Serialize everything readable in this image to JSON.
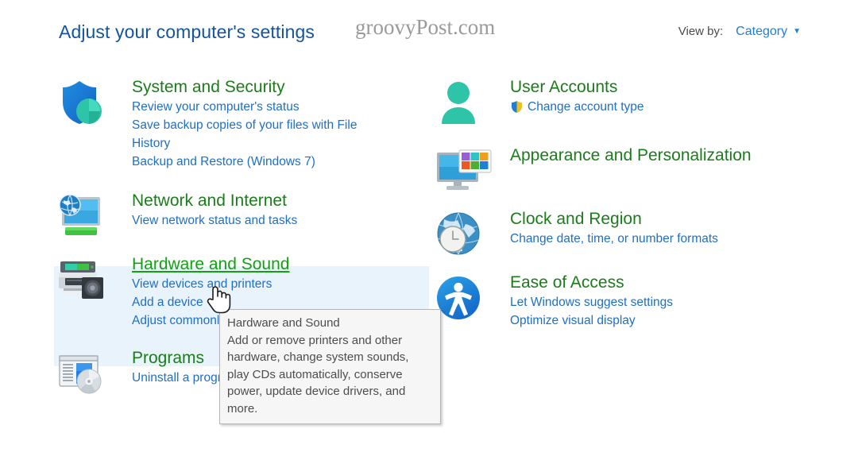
{
  "header": {
    "page_title": "Adjust your computer's settings",
    "watermark": "groovyPost.com",
    "view_by_label": "View by:",
    "view_by_value": "Category",
    "caret_glyph": "▼"
  },
  "colors": {
    "title_blue": "#16539e",
    "link_blue": "#1f6fc4",
    "category_green": "#1a7d1a",
    "hover_green": "#13a013",
    "highlight_band": "#e9f3fc",
    "tooltip_bg": "#f6f6f6",
    "tooltip_border": "#b4b4b4",
    "watermark_gray": "#9a9a9a"
  },
  "left_column": [
    {
      "icon": "shield-security-icon",
      "title": "System and Security",
      "hovered": false,
      "links": [
        "Review your computer's status",
        "Save backup copies of your files with File History",
        "Backup and Restore (Windows 7)"
      ]
    },
    {
      "icon": "network-monitor-globe-icon",
      "title": "Network and Internet",
      "hovered": false,
      "links": [
        "View network status and tasks"
      ]
    },
    {
      "icon": "printer-speaker-icon",
      "title": "Hardware and Sound",
      "hovered": true,
      "links": [
        "View devices and printers",
        "Add a device",
        "Adjust commonly used mobility settings"
      ]
    },
    {
      "icon": "programs-disc-icon",
      "title": "Programs",
      "hovered": false,
      "links": [
        "Uninstall a program"
      ]
    }
  ],
  "right_column": [
    {
      "icon": "user-account-icon",
      "title": "User Accounts",
      "hovered": false,
      "links": [
        "Change account type"
      ],
      "link_icons": [
        "uac-shield-icon"
      ]
    },
    {
      "icon": "monitor-palette-icon",
      "title": "Appearance and Personalization",
      "hovered": false,
      "links": []
    },
    {
      "icon": "globe-clock-icon",
      "title": "Clock and Region",
      "hovered": false,
      "links": [
        "Change date, time, or number formats"
      ]
    },
    {
      "icon": "ease-of-access-icon",
      "title": "Ease of Access",
      "hovered": false,
      "links": [
        "Let Windows suggest settings",
        "Optimize visual display"
      ]
    }
  ],
  "tooltip": {
    "title": "Hardware and Sound",
    "body": "Add or remove printers and other hardware, change system sounds, play CDs automatically, conserve power, update device drivers, and more."
  }
}
